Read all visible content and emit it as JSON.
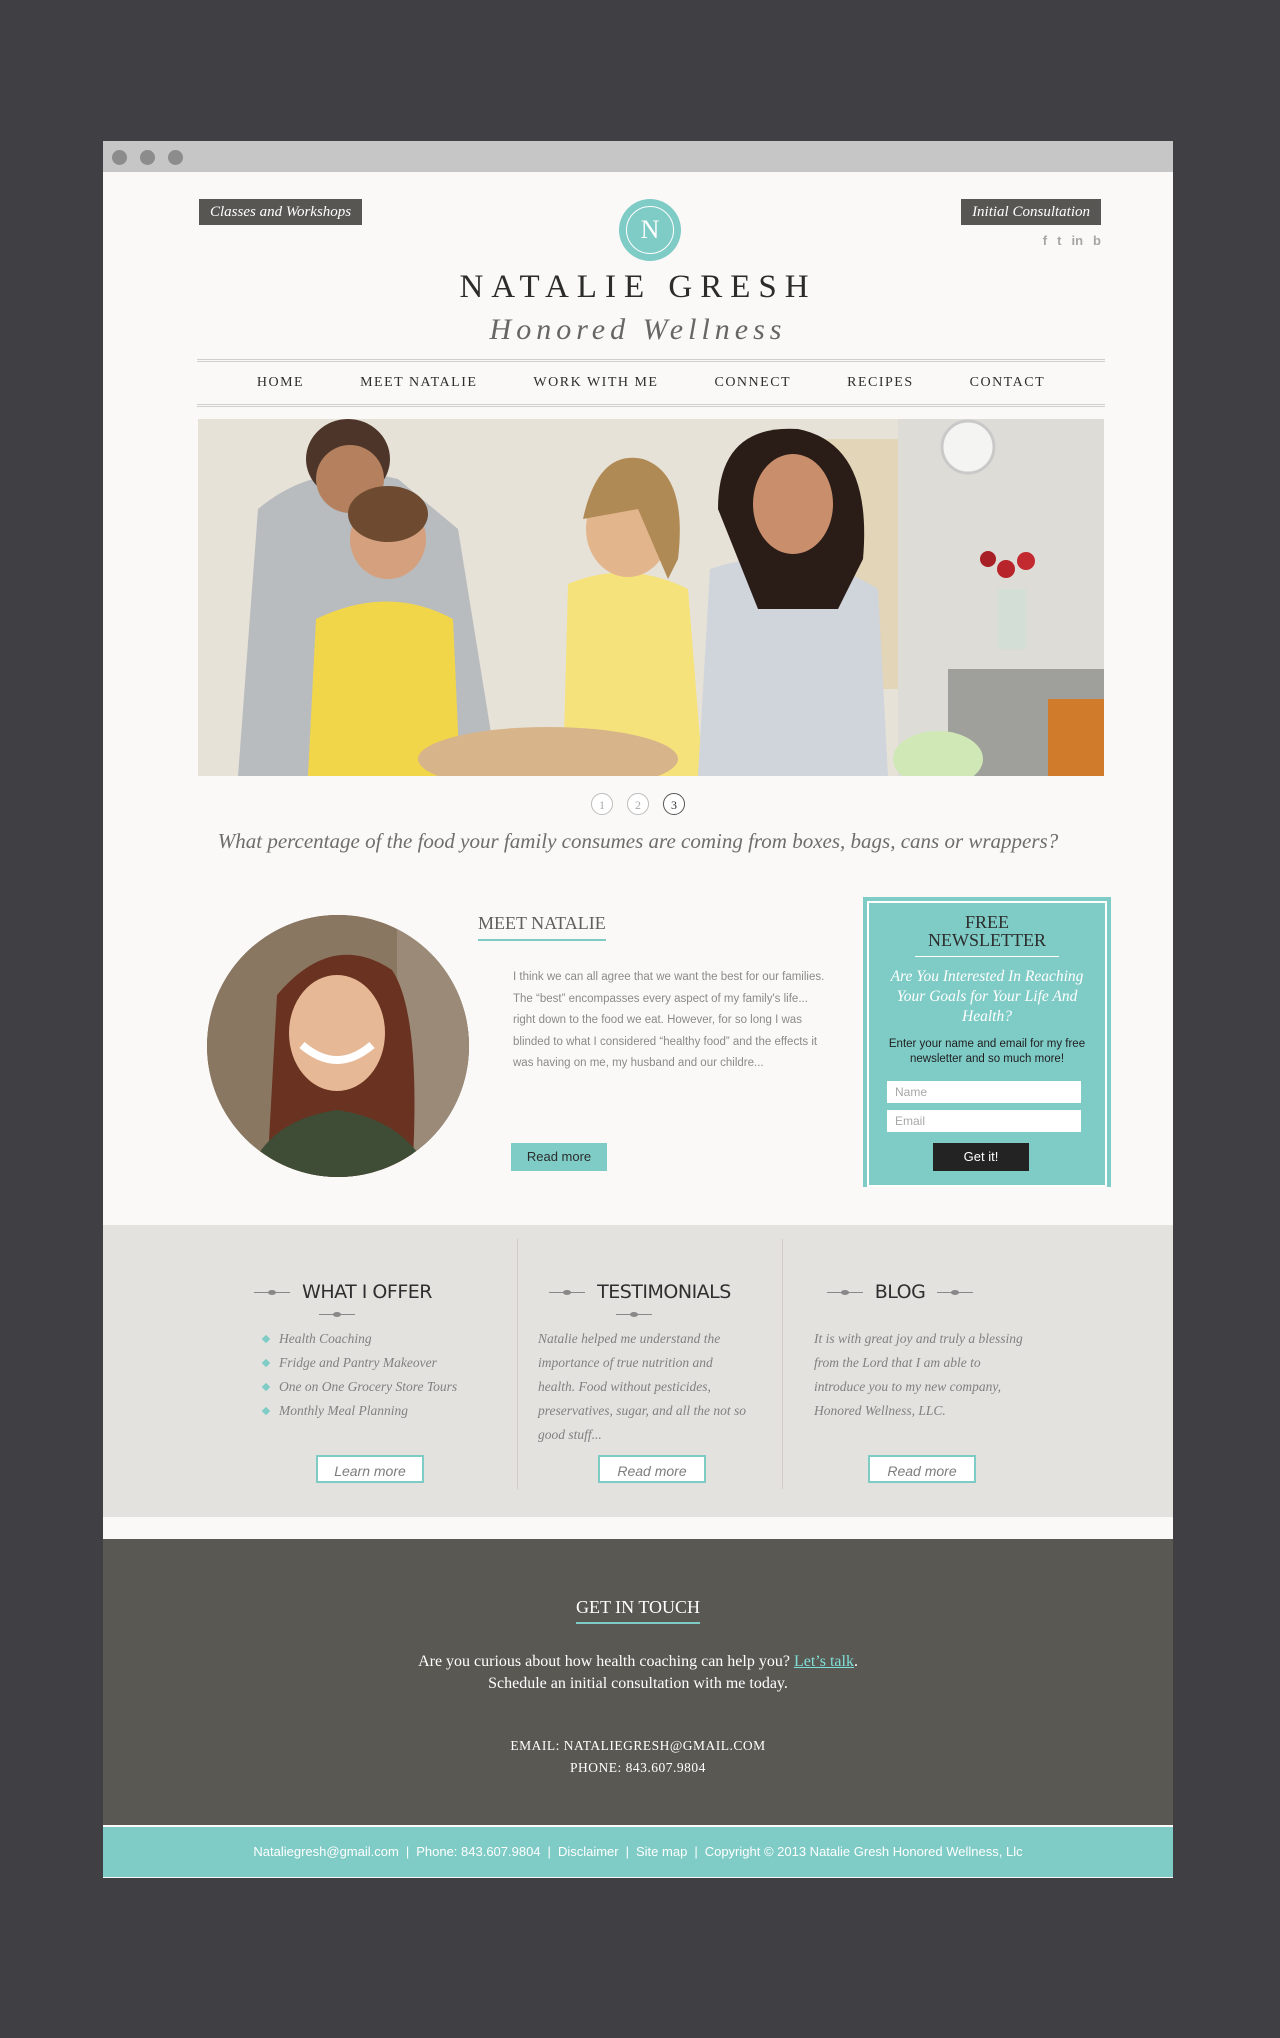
{
  "header": {
    "classes_label": "Classes and Workshops",
    "consultation_label": "Initial Consultation",
    "social": [
      "f",
      "t",
      "in",
      "b"
    ],
    "logo_letter": "N",
    "brand": "NATALIE GRESH",
    "brand_sub": "Honored Wellness"
  },
  "nav": [
    "HOME",
    "MEET NATALIE",
    "WORK WITH ME",
    "CONNECT",
    "RECIPES",
    "CONTACT"
  ],
  "slider": {
    "pages": [
      "1",
      "2",
      "3"
    ],
    "active": 3,
    "tagline": "What percentage of the food your family consumes are coming from boxes, bags, cans or wrappers?"
  },
  "meet": {
    "title": "MEET NATALIE",
    "text": "I think we can all agree that we want the best for our families. The “best” encompasses every aspect of my family's life... right down to the food we eat. However, for so long I was blinded to what I considered “healthy food” and the effects it was having on me, my husband and our childre...",
    "button": "Read more"
  },
  "newsletter": {
    "title_line1": "FREE",
    "title_line2": "NEWSLETTER",
    "question": "Are You Interested In Reaching Your Goals for Your Life And Health?",
    "desc": "Enter your name and email for my free newsletter and so much more!",
    "name_placeholder": "Name",
    "email_placeholder": "Email",
    "button": "Get it!"
  },
  "offer": {
    "title": "WHAT I OFFER",
    "items": [
      "Health Coaching",
      "Fridge and Pantry Makeover",
      "One on One Grocery Store Tours",
      "Monthly Meal Planning"
    ],
    "button": "Learn more"
  },
  "testimonials": {
    "title": "TESTIMONIALS",
    "text": "Natalie helped me understand the importance of true nutrition and health. Food without pesticides, preservatives, sugar, and all the not so good stuff...",
    "button": "Read more"
  },
  "blog": {
    "title": "BLOG",
    "text": "It is with great joy and truly a blessing from the Lord that I am able to introduce you to my new company, Honored Wellness, LLC.",
    "button": "Read more"
  },
  "contact": {
    "title": "GET IN TOUCH",
    "line1": "Are you curious about how health coaching can help you?",
    "link": "Let’s talk",
    "line2": "Schedule an initial consultation with me today.",
    "email": "EMAIL:  NATALIEGRESH@GMAIL.COM",
    "phone": "PHONE:  843.607.9804"
  },
  "footer": {
    "email": "Nataliegresh@gmail.com",
    "phone": "Phone: 843.607.9804",
    "disclaimer": "Disclaimer",
    "sitemap": "Site map",
    "copyright": "Copyright ©  2013 Natalie Gresh Honored Wellness, Llc"
  },
  "colors": {
    "accent": "#7fcbc6",
    "dark": "#575652",
    "background": "#403f43"
  }
}
